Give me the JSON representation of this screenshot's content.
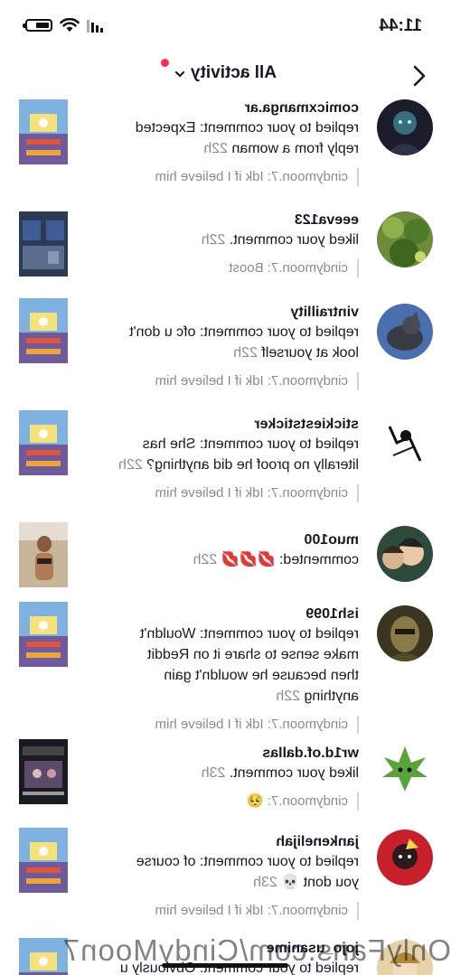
{
  "status_bar": {
    "time": "11:44"
  },
  "header": {
    "title": "All activity"
  },
  "colors": {
    "accent": "#fe2c55",
    "muted": "#8a8b91"
  },
  "items": [
    {
      "username": "comicxmanga.ar",
      "message": "replied to your comment: Expected reply from a woman",
      "time": "22h",
      "quote": "cindymoon.7: Idk if I believe him",
      "avatar": "dark-character-avatar",
      "thumb": "game-video-thumbnail"
    },
    {
      "username": "eeeva123",
      "message": "liked your comment.",
      "time": "22h",
      "quote": "cindymoon.7: Boost",
      "avatar": "garden-avatar",
      "thumb": "room-video-thumbnail"
    },
    {
      "username": "vintraillity",
      "message": "replied to your comment: ofc u don't look at yourself",
      "time": "22h",
      "quote": "cindymoon.7: Idk if I believe him",
      "avatar": "cat-avatar",
      "thumb": "game-video-thumbnail"
    },
    {
      "username": "stickieststicker",
      "message": "replied to your comment: She has literally no proof he did anything?",
      "time": "22h",
      "quote": "cindymoon.7: Idk if I believe him",
      "avatar": "sketch-avatar",
      "thumb": "game-video-thumbnail"
    },
    {
      "username": "muo100",
      "message": "commented: 💋💋💋",
      "time": "22h",
      "quote": "",
      "avatar": "anime-avatar",
      "thumb": "person-video-thumbnail"
    },
    {
      "username": "ish1099",
      "message": "replied to your comment: Wouldn't make sense to share it on Reddit then because he wouldn't gain anything",
      "time": "22h",
      "quote": "cindymoon.7: Idk if I believe him",
      "avatar": "masked-avatar",
      "thumb": "game-video-thumbnail"
    },
    {
      "username": "wr1d.of.dallas",
      "message": "liked your comment.",
      "time": "23h",
      "quote": "cindymoon.7: 🥺",
      "avatar": "leaf-avatar",
      "thumb": "news-video-thumbnail"
    },
    {
      "username": "jankenelijah",
      "message": "replied to your comment: of course you dont 💀",
      "time": "23h",
      "quote": "cindymoon.7: Idk if I believe him",
      "avatar": "red-character-avatar",
      "thumb": "game-video-thumbnail"
    },
    {
      "username": "jojo_usanime",
      "message": "replied to your comment: Obviously u",
      "time": "",
      "quote": "",
      "avatar": "anime-avatar",
      "thumb": "game-video-thumbnail"
    }
  ],
  "watermark": "OnlyFans.com/CindyMoon7"
}
